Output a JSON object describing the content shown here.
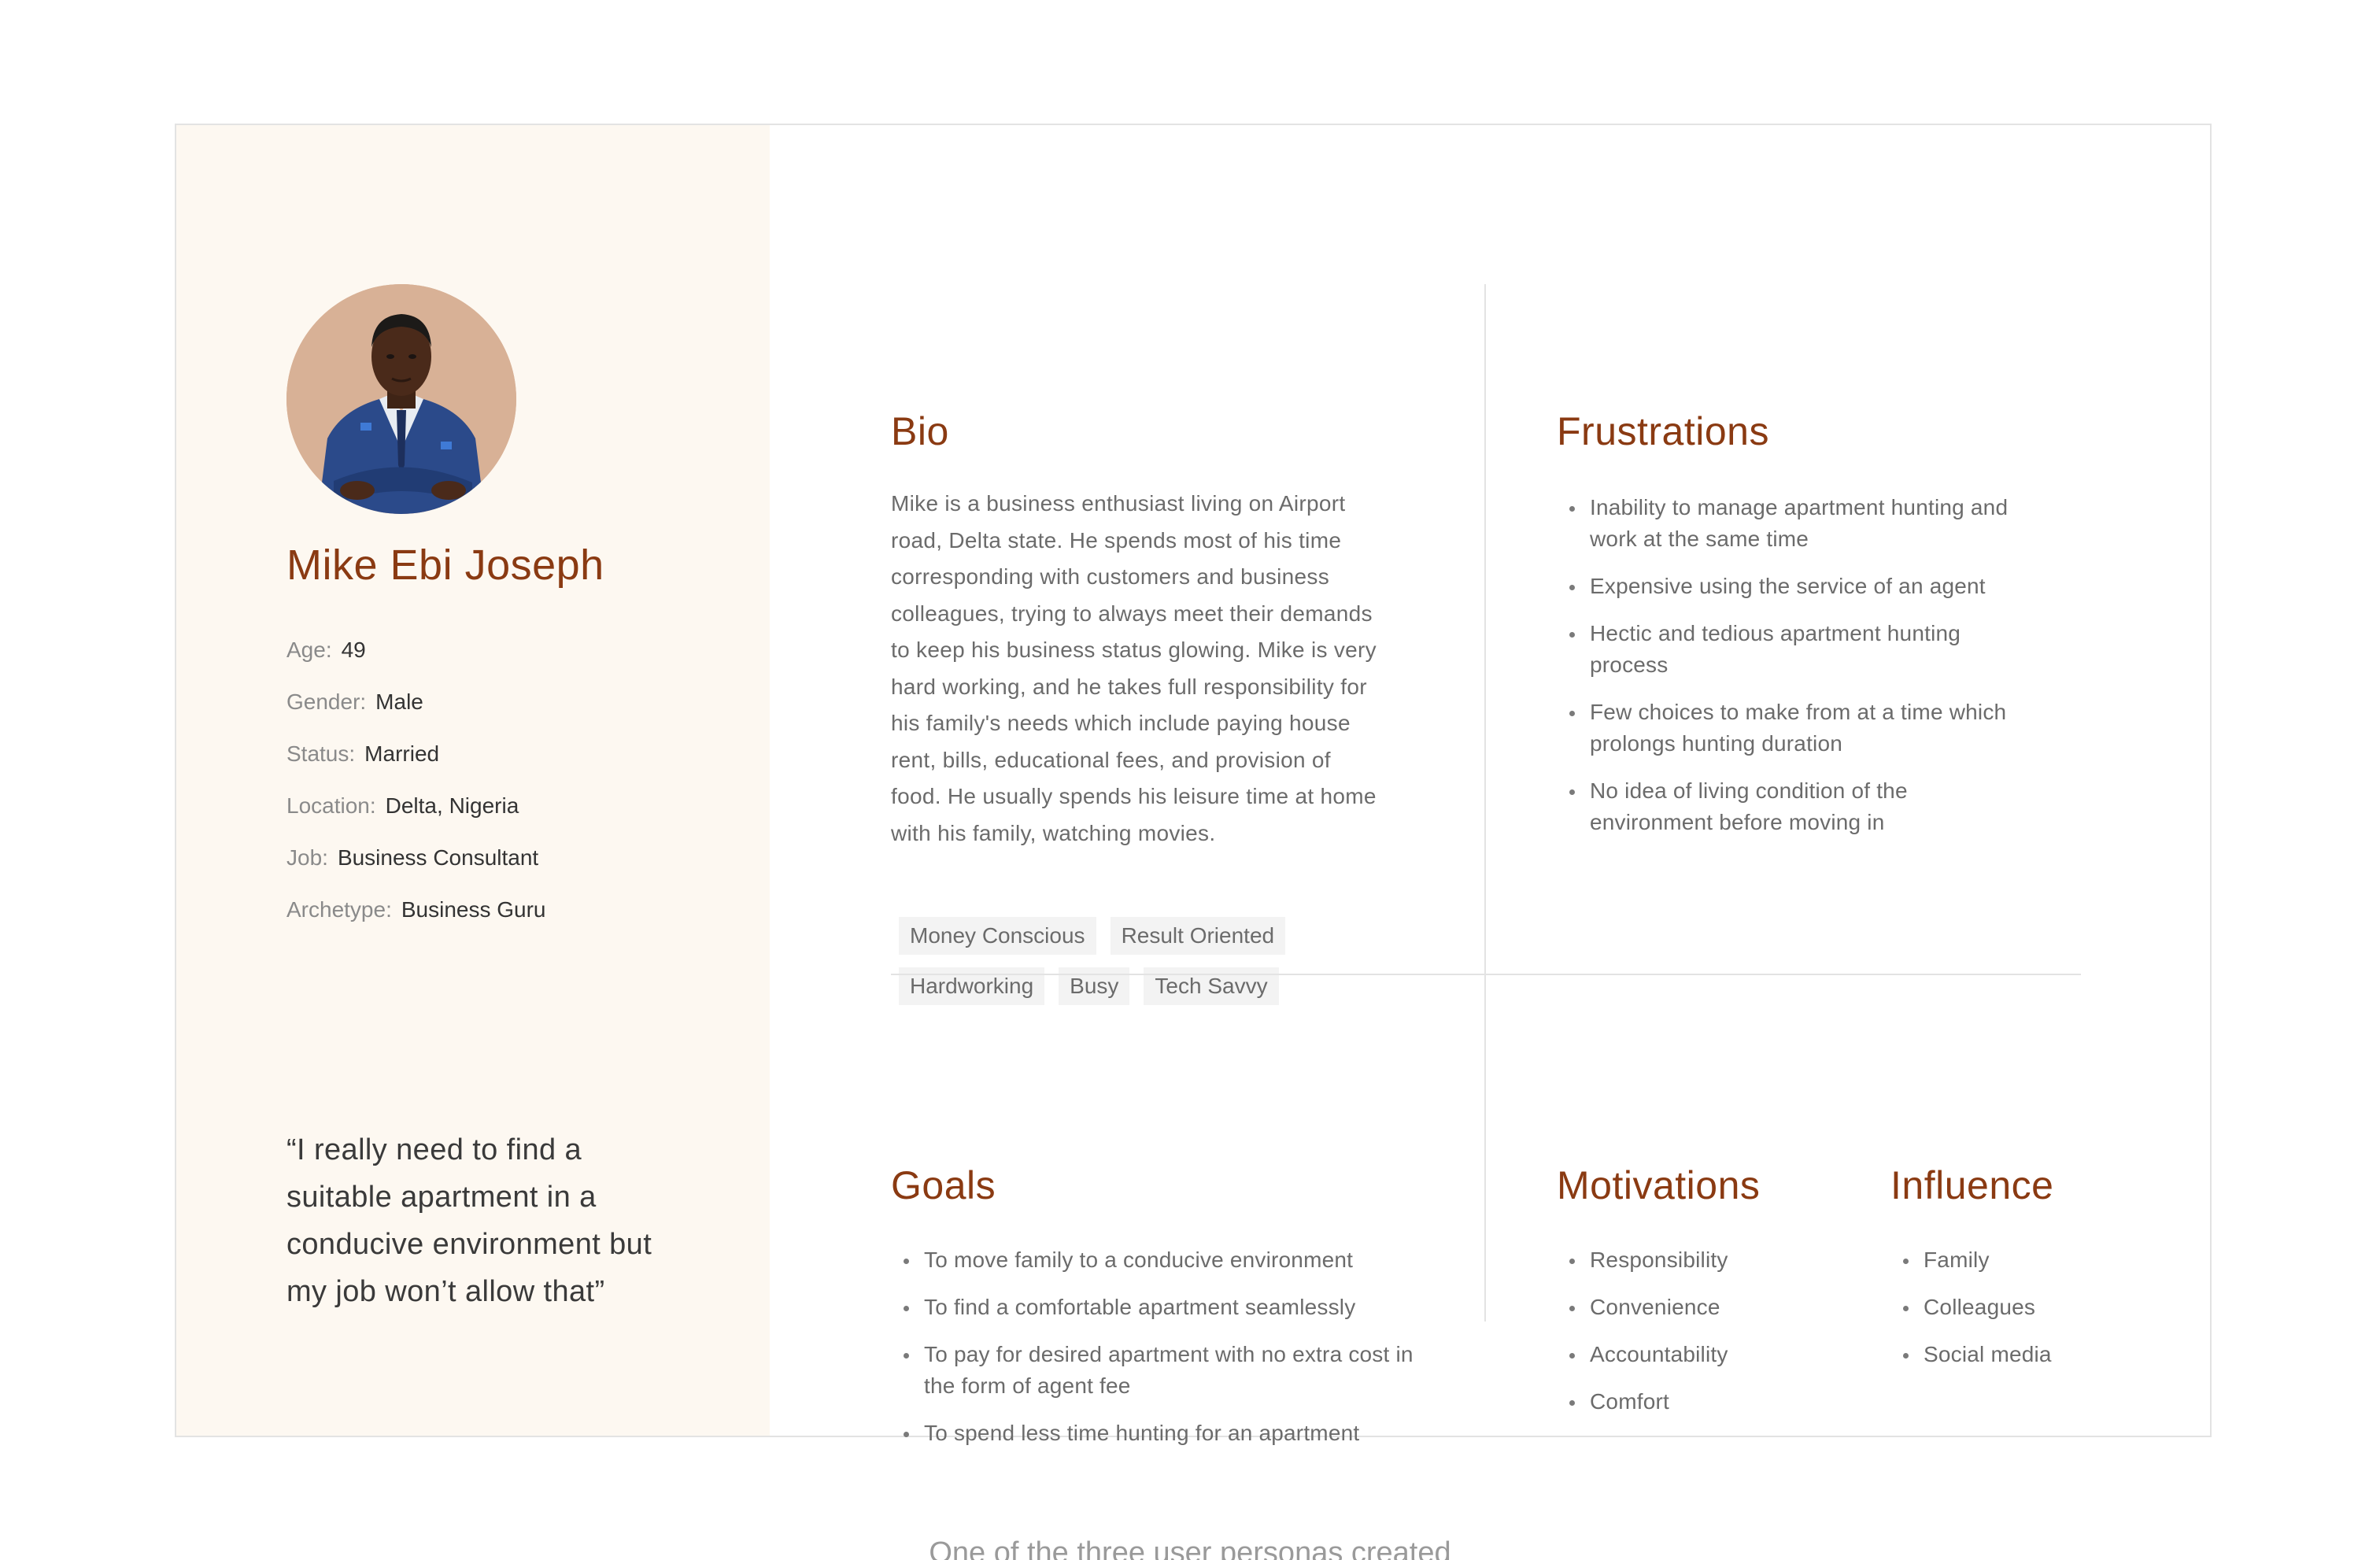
{
  "persona": {
    "name": "Mike Ebi Joseph",
    "details": [
      {
        "key": "Age:",
        "value": "49"
      },
      {
        "key": "Gender:",
        "value": "Male"
      },
      {
        "key": "Status:",
        "value": "Married"
      },
      {
        "key": "Location:",
        "value": "Delta, Nigeria"
      },
      {
        "key": "Job:",
        "value": "Business Consultant"
      },
      {
        "key": "Archetype:",
        "value": "Business Guru"
      }
    ],
    "quote": "“I really need to find a suitable apartment in a conducive environment but my job won’t allow that”"
  },
  "bio": {
    "title": "Bio",
    "text": "Mike is a business enthusiast living on Airport road, Delta state. He spends most of his time corresponding with customers and business colleagues, trying to always meet their demands to keep his business status glowing. Mike is very hard working, and he takes full responsibility for his family's needs which include paying house rent, bills, educational fees, and provision of food. He usually spends his leisure time at home with his family, watching movies.",
    "tags": [
      "Money Conscious",
      "Result Oriented",
      "Hardworking",
      "Busy",
      "Tech Savvy"
    ]
  },
  "frustrations": {
    "title": "Frustrations",
    "items": [
      "Inability to manage apartment hunting and work at the same time",
      "Expensive using the service of an agent",
      "Hectic and tedious apartment hunting process",
      "Few choices to make from at a time which prolongs hunting duration",
      "No idea of living condition of the environment before moving in"
    ]
  },
  "goals": {
    "title": "Goals",
    "items": [
      "To move family to a conducive environment",
      "To find a comfortable apartment seamlessly",
      "To pay for desired apartment with no extra cost in the form of agent fee",
      "To spend less time hunting for an apartment"
    ]
  },
  "motivations": {
    "title": "Motivations",
    "items": [
      "Responsibility",
      "Convenience",
      "Accountability",
      "Comfort"
    ]
  },
  "influence": {
    "title": "Influence",
    "items": [
      "Family",
      "Colleagues",
      "Social media"
    ]
  },
  "caption": "One of the three user personas created",
  "colors": {
    "accent": "#8a3a12",
    "panel_bg": "#fdf8f1",
    "tag_bg": "#f3f3f3",
    "avatar_bg": "#d8b196"
  }
}
